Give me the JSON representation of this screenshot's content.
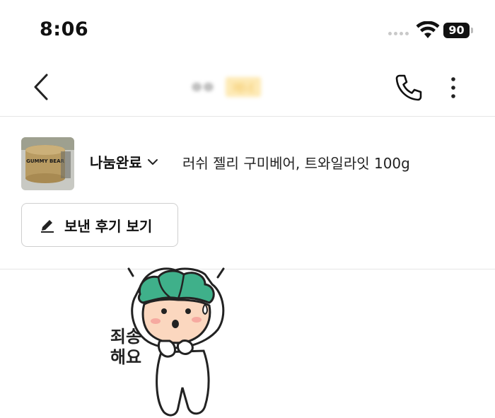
{
  "status_bar": {
    "time": "8:06",
    "battery": "90"
  },
  "nav": {
    "title_name": "ㅇㅇ",
    "title_badge": "매너"
  },
  "product": {
    "status": "나눔완료",
    "title": "러쉬 젤리 구미베어, 트와일라잇 100g",
    "thumbnail_text": "GUMMY BEAR",
    "review_button": "보낸 후기 보기"
  },
  "sticker": {
    "text_line1": "죄송",
    "text_line2": "해요"
  }
}
